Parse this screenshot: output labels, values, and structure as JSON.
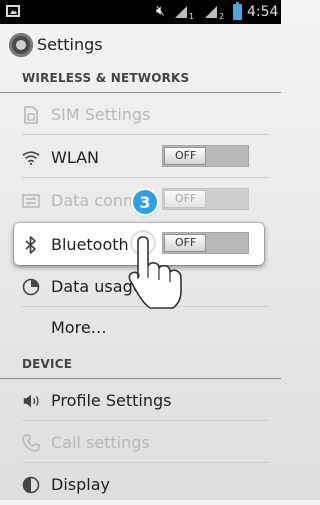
{
  "status_bar": {
    "time": "4:54",
    "sim1": "1",
    "sim2": "2",
    "battery_color": "#4ea6d4"
  },
  "action_bar": {
    "title": "Settings"
  },
  "sections": {
    "wireless": "WIRELESS & NETWORKS",
    "device": "DEVICE"
  },
  "items": {
    "sim_settings": {
      "label": "SIM Settings",
      "icon": "sim-card-icon"
    },
    "wlan": {
      "label": "WLAN",
      "icon": "wifi-icon",
      "toggle": "OFF"
    },
    "data_connection": {
      "label": "Data conne",
      "icon": "data-connection-icon",
      "toggle": "OFF"
    },
    "bluetooth": {
      "label": "Bluetooth",
      "icon": "bluetooth-icon",
      "toggle": "OFF"
    },
    "data_usage": {
      "label": "Data usage",
      "icon": "pie-chart-icon"
    },
    "more": {
      "label": "More…"
    },
    "profile_settings": {
      "label": "Profile Settings",
      "icon": "speaker-icon"
    },
    "call_settings": {
      "label": "Call settings",
      "icon": "phone-icon"
    },
    "display": {
      "label": "Display",
      "icon": "display-icon"
    }
  },
  "tutorial": {
    "step": "3",
    "accent": "#2f9fe6"
  }
}
